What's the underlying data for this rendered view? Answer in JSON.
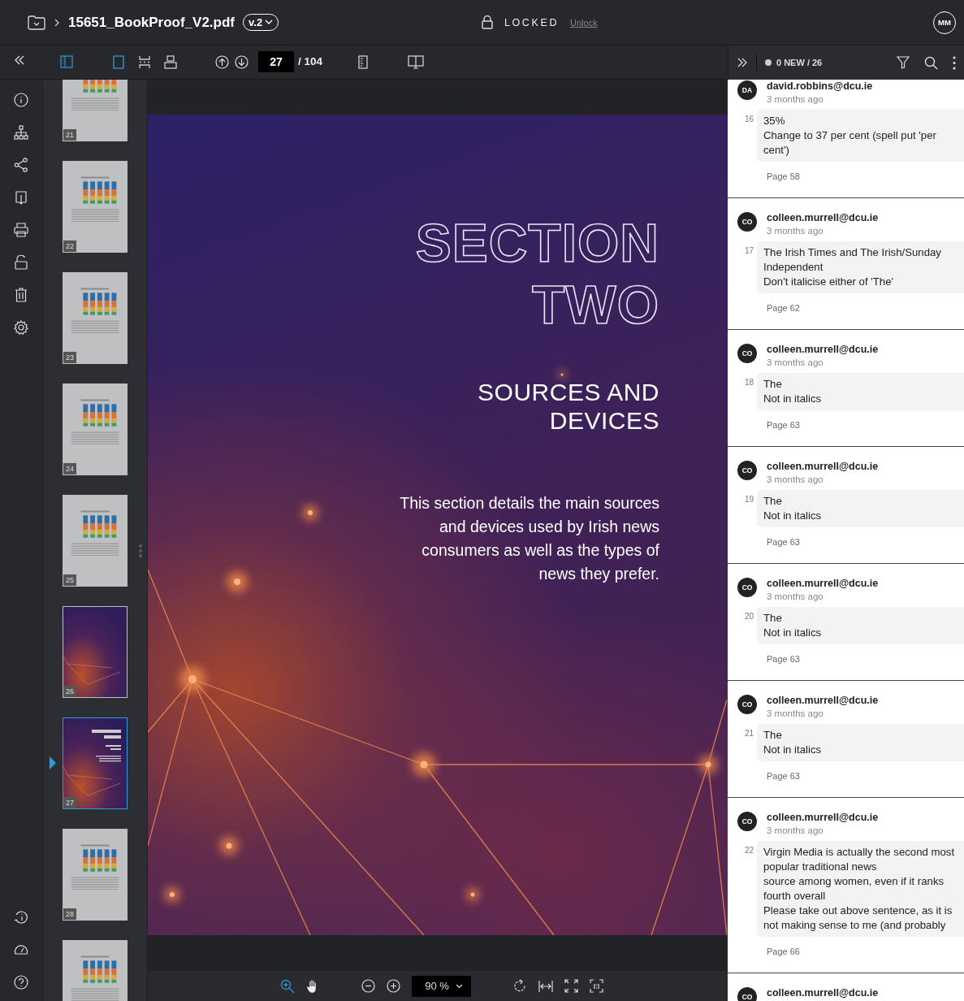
{
  "header": {
    "filename": "15651_BookProof_V2.pdf",
    "version": "v.2",
    "lock_status": "LOCKED",
    "unlock_link": "Unlock",
    "user_initials": "MM"
  },
  "toolbar": {
    "thumbnails_open": true,
    "view_modes": [
      {
        "kind": "single",
        "selected": true
      },
      {
        "kind": "continuous",
        "selected": false
      },
      {
        "kind": "facing",
        "selected": false
      }
    ],
    "page_current": "27",
    "page_total": "/ 104"
  },
  "thumbnails": [
    {
      "label": "21",
      "kind": "chart",
      "selected": false
    },
    {
      "label": "22",
      "kind": "chart",
      "selected": false
    },
    {
      "label": "23",
      "kind": "chart",
      "selected": false
    },
    {
      "label": "24",
      "kind": "chart",
      "selected": false
    },
    {
      "label": "25",
      "kind": "chart",
      "selected": false
    },
    {
      "label": "26",
      "kind": "photo",
      "selected": false
    },
    {
      "label": "27",
      "kind": "section",
      "selected": true
    },
    {
      "label": "28",
      "kind": "chart",
      "selected": false
    },
    {
      "kind": "chart",
      "selected": false
    }
  ],
  "page": {
    "title_lines": [
      "SECTION",
      "TWO"
    ],
    "subtitle_lines": [
      "SOURCES AND",
      "DEVICES"
    ],
    "description_lines": [
      "This section details the main sources",
      "and devices used by Irish news",
      "consumers as well as the types of",
      "news they prefer."
    ]
  },
  "zoom_bar": {
    "tools": [
      {
        "kind": "zoom",
        "selected": true
      },
      {
        "kind": "pan",
        "selected": false
      }
    ],
    "zoom_level": "90 %"
  },
  "comments_header": {
    "counter": "0 NEW / 26"
  },
  "comments": [
    {
      "initials": "DA",
      "author": "david.robbins@dcu.ie",
      "time": "3 months ago",
      "number": "16",
      "lines": [
        "35%",
        "Change to 37 per cent (spell put 'per cent')"
      ],
      "page": "Page 58"
    },
    {
      "initials": "CO",
      "author": "colleen.murrell@dcu.ie",
      "time": "3 months ago",
      "number": "17",
      "lines": [
        "The Irish Times and The Irish/Sunday Independent",
        "Don't italicise either of 'The'"
      ],
      "page": "Page 62"
    },
    {
      "initials": "CO",
      "author": "colleen.murrell@dcu.ie",
      "time": "3 months ago",
      "number": "18",
      "lines": [
        "The",
        "Not in italics"
      ],
      "page": "Page 63"
    },
    {
      "initials": "CO",
      "author": "colleen.murrell@dcu.ie",
      "time": "3 months ago",
      "number": "19",
      "lines": [
        "The",
        "Not in italics"
      ],
      "page": "Page 63"
    },
    {
      "initials": "CO",
      "author": "colleen.murrell@dcu.ie",
      "time": "3 months ago",
      "number": "20",
      "lines": [
        "The",
        "Not in italics"
      ],
      "page": "Page 63"
    },
    {
      "initials": "CO",
      "author": "colleen.murrell@dcu.ie",
      "time": "3 months ago",
      "number": "21",
      "lines": [
        "The",
        "Not in italics"
      ],
      "page": "Page 63"
    },
    {
      "initials": "CO",
      "author": "colleen.murrell@dcu.ie",
      "time": "3 months ago",
      "number": "22",
      "lines": [
        "Virgin Media is actually the second most popular traditional news",
        "source among women, even if it ranks fourth overall",
        "Please take out above sentence, as it is not making sense to me (and probably"
      ],
      "page": "Page 66"
    },
    {
      "initials": "CO",
      "author": "colleen.murrell@dcu.ie"
    }
  ]
}
